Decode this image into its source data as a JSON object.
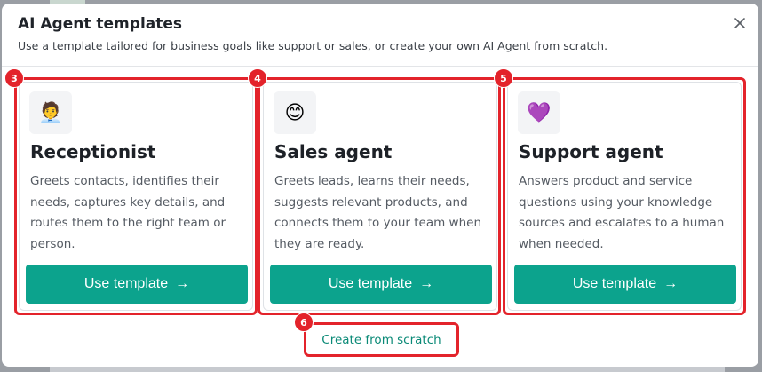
{
  "modal": {
    "title": "AI Agent templates",
    "subtitle": "Use a template tailored for business goals like support or sales, or create your own AI Agent from scratch.",
    "close_icon": "close-icon"
  },
  "cards": [
    {
      "badge": "3",
      "icon": "🧑‍💼",
      "icon_name": "receptionist-emoji-icon",
      "title": "Receptionist",
      "description": "Greets contacts, identifies their needs, captures key details, and routes them to the right team or person.",
      "button_label": "Use template",
      "button_arrow": "→"
    },
    {
      "badge": "4",
      "icon": "😊",
      "icon_name": "smiling-face-emoji-icon",
      "title": "Sales agent",
      "description": "Greets leads, learns their needs, suggests relevant products, and connects them to your team when they are ready.",
      "button_label": "Use template",
      "button_arrow": "→"
    },
    {
      "badge": "5",
      "icon": "💜",
      "icon_name": "purple-heart-emoji-icon",
      "title": "Support agent",
      "description": "Answers product and service questions using your knowledge sources and escalates to a human when needed.",
      "button_label": "Use template",
      "button_arrow": "→"
    }
  ],
  "scratch": {
    "badge": "6",
    "label": "Create from scratch"
  },
  "colors": {
    "accent": "#0ca38d",
    "link": "#0b8a77",
    "annotation_red": "#e3232b"
  }
}
